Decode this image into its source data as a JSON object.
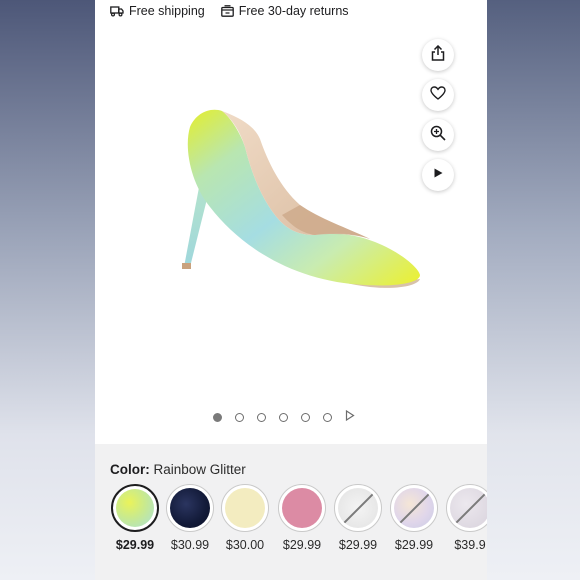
{
  "topbar": {
    "shipping_label": "Free shipping",
    "returns_label": "Free 30-day returns"
  },
  "gallery": {
    "image_alt": "Rainbow glitter pointed-toe high heel pump",
    "actions": [
      {
        "name": "share",
        "icon": "share-icon"
      },
      {
        "name": "favorite",
        "icon": "heart-icon"
      },
      {
        "name": "zoom",
        "icon": "zoom-in-icon"
      },
      {
        "name": "video",
        "icon": "play-icon"
      }
    ],
    "image_count": 6,
    "active_index": 0
  },
  "color": {
    "label": "Color:",
    "selected_value": "Rainbow Glitter",
    "swatches": [
      {
        "price": "$29.99",
        "selected": true,
        "available": true
      },
      {
        "price": "$30.99",
        "selected": false,
        "available": true
      },
      {
        "price": "$30.00",
        "selected": false,
        "available": true
      },
      {
        "price": "$29.99",
        "selected": false,
        "available": true
      },
      {
        "price": "$29.99",
        "selected": false,
        "available": false
      },
      {
        "price": "$29.99",
        "selected": false,
        "available": false
      },
      {
        "price": "$39.9",
        "selected": false,
        "available": false
      }
    ]
  },
  "colors": {
    "accent": "#1d1d1f",
    "section_bg": "#f1f1f2",
    "dot": "#7a7a7a"
  }
}
